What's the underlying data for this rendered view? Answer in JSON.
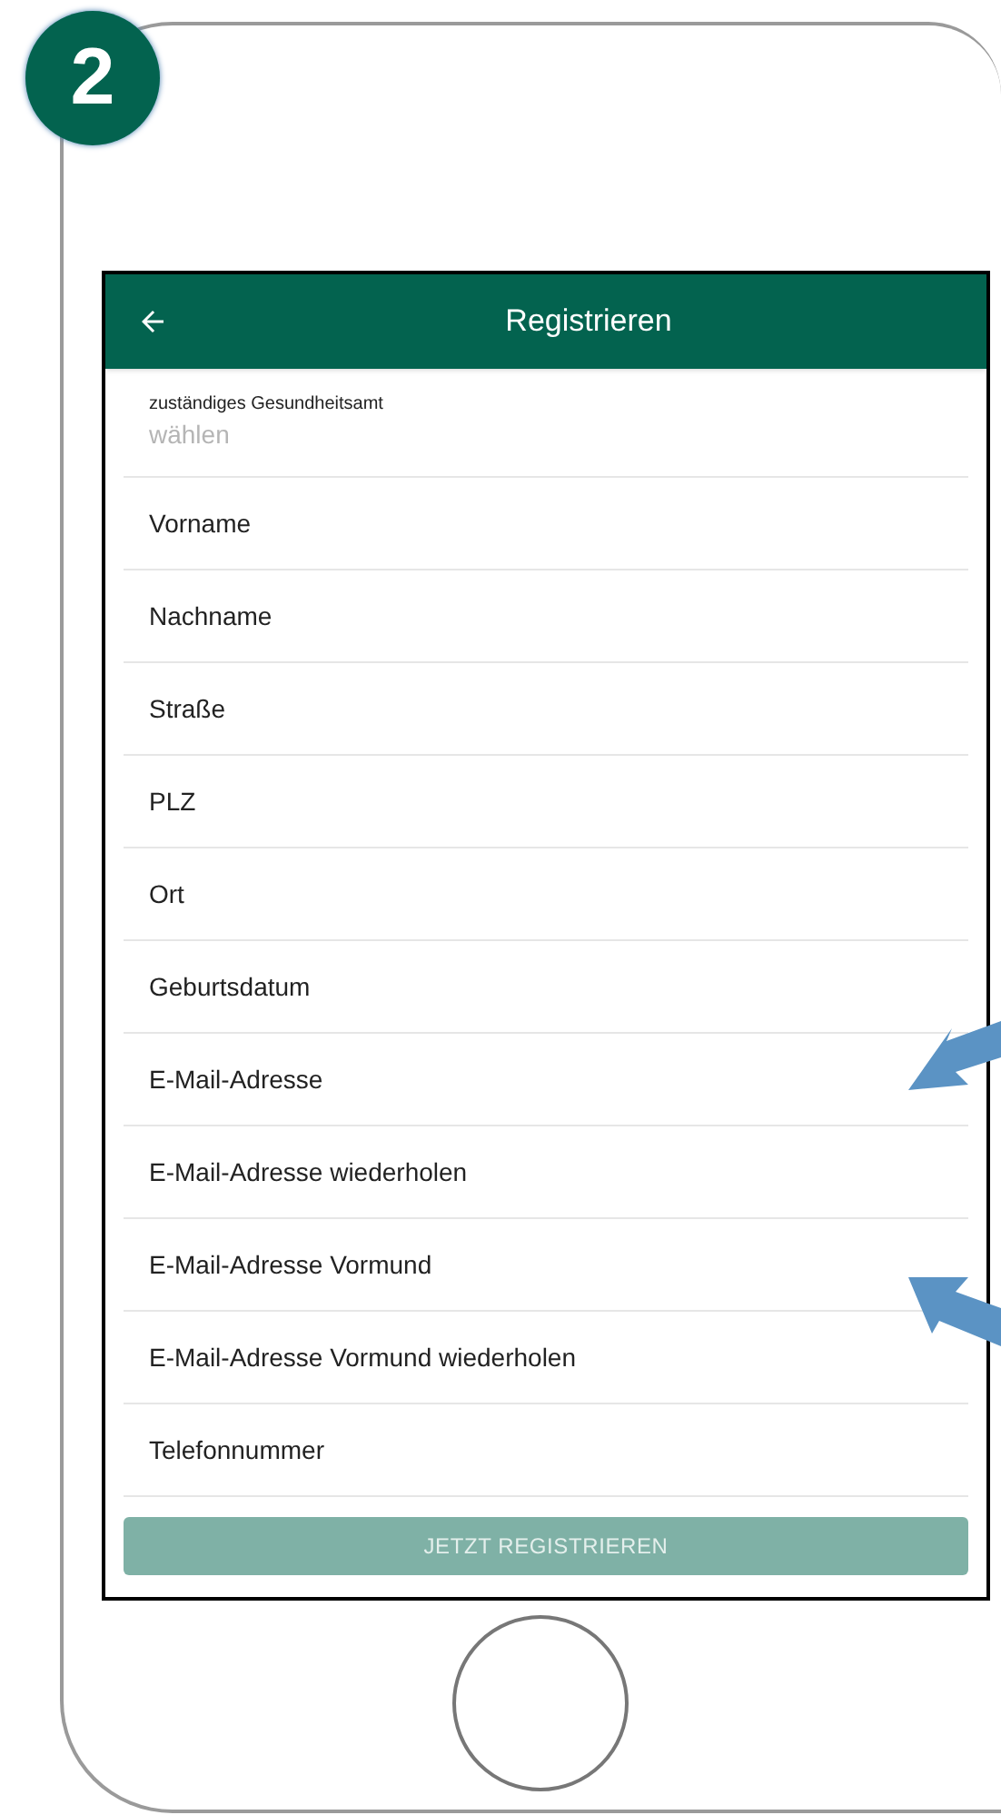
{
  "step_badge": "2",
  "app_bar": {
    "title": "Registrieren"
  },
  "fields": [
    {
      "kind": "select",
      "label": "zuständiges Gesundheitsamt",
      "placeholder": "wählen"
    },
    {
      "kind": "text",
      "placeholder": "Vorname"
    },
    {
      "kind": "text",
      "placeholder": "Nachname"
    },
    {
      "kind": "text",
      "placeholder": "Straße"
    },
    {
      "kind": "text",
      "placeholder": "PLZ"
    },
    {
      "kind": "text",
      "placeholder": "Ort"
    },
    {
      "kind": "text",
      "placeholder": "Geburtsdatum"
    },
    {
      "kind": "text",
      "placeholder": "E-Mail-Adresse"
    },
    {
      "kind": "text",
      "placeholder": "E-Mail-Adresse wiederholen"
    },
    {
      "kind": "text",
      "placeholder": "E-Mail-Adresse Vormund"
    },
    {
      "kind": "text",
      "placeholder": "E-Mail-Adresse Vormund wiederholen"
    },
    {
      "kind": "text",
      "placeholder": "Telefonnummer"
    }
  ],
  "submit_button": {
    "label": "JETZT REGISTRIEREN",
    "disabled": true
  }
}
